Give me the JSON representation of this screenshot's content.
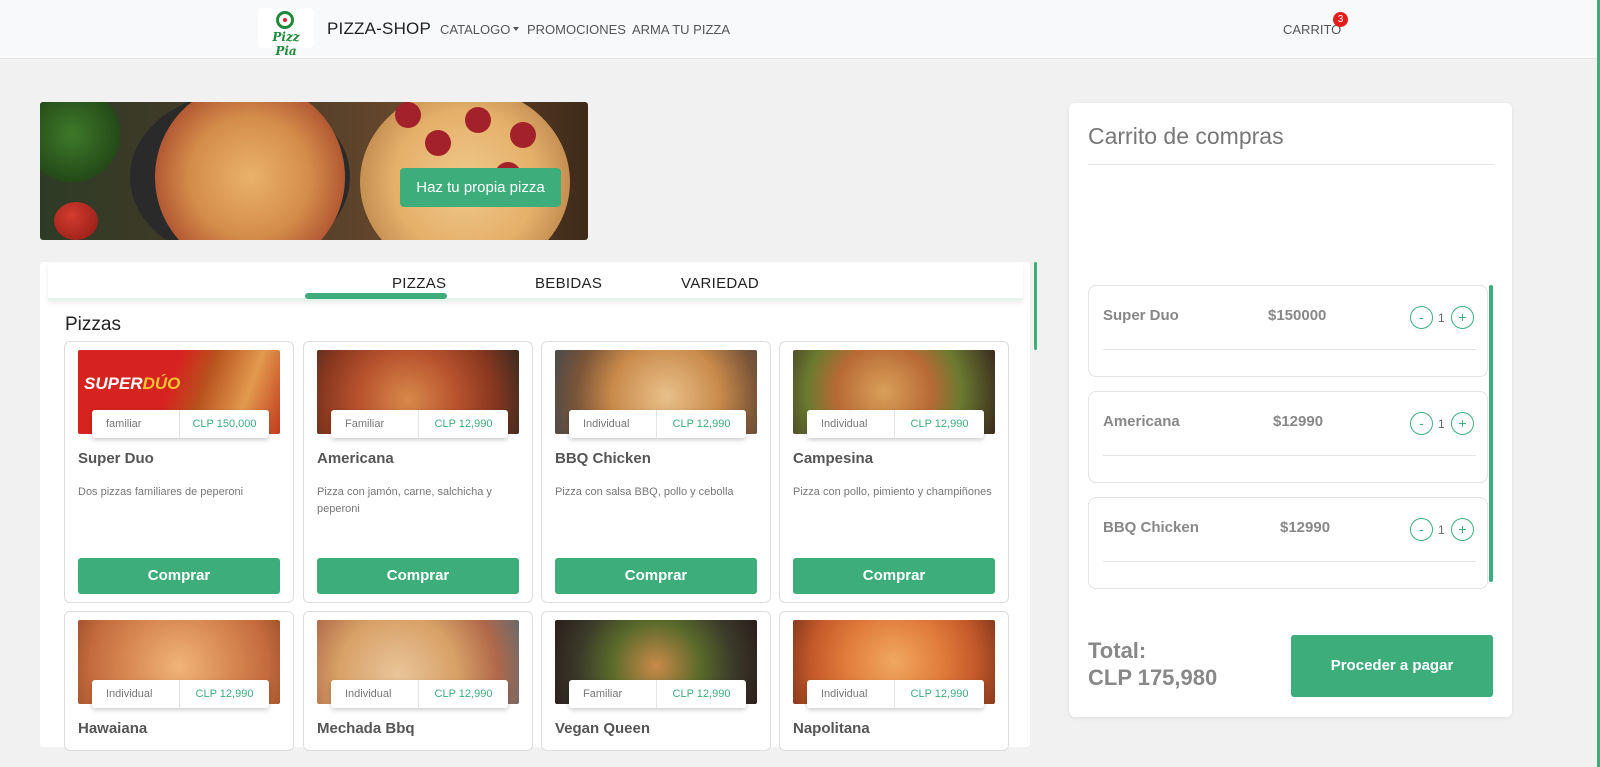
{
  "navbar": {
    "logo_text": "Pizz Pia",
    "brand": "PIZZA-SHOP",
    "links": [
      "CATALOGO",
      "PROMOCIONES",
      "ARMA TU PIZZA"
    ],
    "cart_label": "CARRITO",
    "cart_count": "3"
  },
  "banner": {
    "cta": "Haz tu propia pizza"
  },
  "tabs": [
    "PIZZAS",
    "BEBIDAS",
    "VARIEDAD"
  ],
  "section_title": "Pizzas",
  "products": [
    {
      "name": "Super Duo",
      "size": "familiar",
      "price": "CLP 150,000",
      "desc": "Dos pizzas familiares de peperoni",
      "button": "Comprar"
    },
    {
      "name": "Americana",
      "size": "Familiar",
      "price": "CLP 12,990",
      "desc": "Pizza con jamón, carne, salchicha y peperoni",
      "button": "Comprar"
    },
    {
      "name": "BBQ Chicken",
      "size": "Individual",
      "price": "CLP 12,990",
      "desc": "Pizza con salsa BBQ, pollo y cebolla",
      "button": "Comprar"
    },
    {
      "name": "Campesina",
      "size": "Individual",
      "price": "CLP 12,990",
      "desc": "Pizza con pollo, pimiento y champiñones",
      "button": "Comprar"
    },
    {
      "name": "Hawaiana",
      "size": "Individual",
      "price": "CLP 12,990"
    },
    {
      "name": "Mechada Bbq",
      "size": "Individual",
      "price": "CLP 12,990"
    },
    {
      "name": "Vegan Queen",
      "size": "Familiar",
      "price": "CLP 12,990"
    },
    {
      "name": "Napolitana",
      "size": "Individual",
      "price": "CLP 12,990"
    }
  ],
  "cart": {
    "title": "Carrito de compras",
    "items": [
      {
        "name": "Super Duo",
        "price": "$150000",
        "qty": "1",
        "minus": "-",
        "plus": "+"
      },
      {
        "name": "Americana",
        "price": "$12990",
        "qty": "1",
        "minus": "-",
        "plus": "+"
      },
      {
        "name": "BBQ Chicken",
        "price": "$12990",
        "qty": "1",
        "minus": "-",
        "plus": "+"
      }
    ],
    "total_label": "Total:",
    "total_value": "CLP 175,980",
    "pay_button": "Proceder a pagar"
  },
  "colors": {
    "accent": "#3ead7c",
    "badge": "#e51c1c",
    "background": "#f1f1f1"
  }
}
